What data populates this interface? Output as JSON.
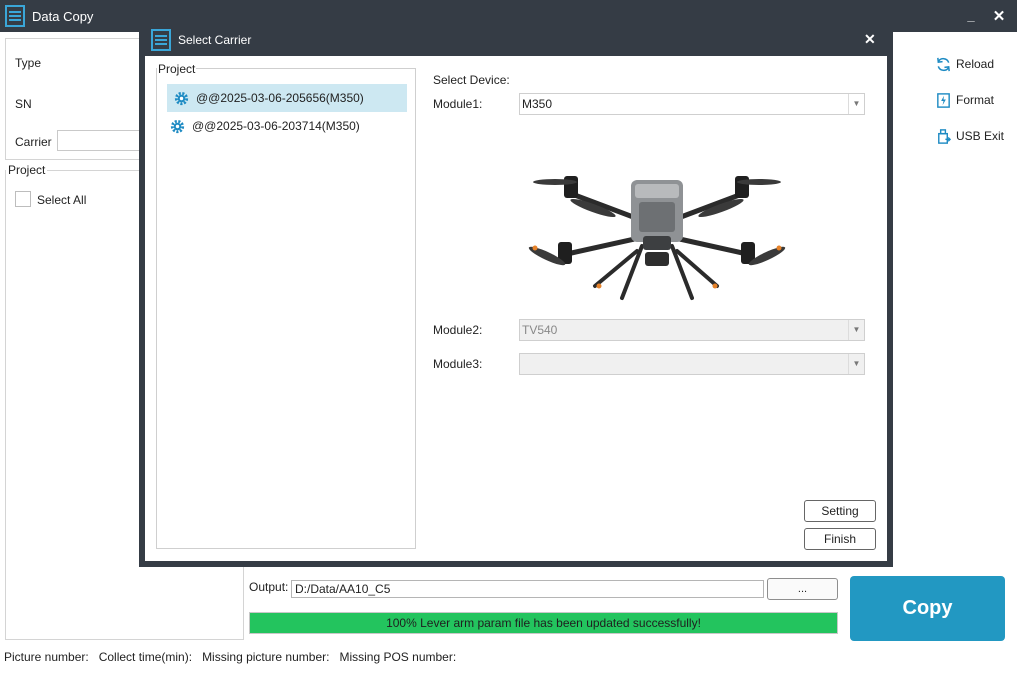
{
  "window": {
    "title": "Data Copy",
    "minimize_glyph": "_",
    "close_glyph": "✕"
  },
  "info": {
    "type_label": "Type",
    "sn_label": "SN",
    "carrier_label": "Carrier"
  },
  "project_panel": {
    "legend": "Project",
    "select_all_label": "Select All"
  },
  "side_buttons": {
    "reload": "Reload",
    "format": "Format",
    "usb_exit": "USB Exit"
  },
  "output": {
    "label": "Output:",
    "path": "D:/Data/AA10_C5",
    "browse_label": "...",
    "progress_text": "100% Lever arm param file has been updated successfully!",
    "progress_percent": 100
  },
  "copy_button": "Copy",
  "status_bar": {
    "picture_number": "Picture number:",
    "collect_time": "Collect time(min):",
    "missing_picture": "Missing picture number:",
    "missing_pos": "Missing POS number:"
  },
  "dialog": {
    "title": "Select Carrier",
    "close_glyph": "✕",
    "project_legend": "Project",
    "projects": [
      {
        "name": "@@2025-03-06-205656(M350)",
        "selected": true
      },
      {
        "name": "@@2025-03-06-203714(M350)",
        "selected": false
      }
    ],
    "select_device_label": "Select Device:",
    "module1_label": "Module1:",
    "module1_value": "M350",
    "module2_label": "Module2:",
    "module2_value": "TV540",
    "module3_label": "Module3:",
    "module3_value": "",
    "setting_button": "Setting",
    "finish_button": "Finish"
  },
  "colors": {
    "titlebar": "#353c45",
    "accent": "#2298c2",
    "progress": "#23c45e",
    "selected_row": "#cde8f2"
  },
  "icons": {
    "app": "document-list-icon",
    "reload": "refresh-icon",
    "format": "format-drive-icon",
    "usb_exit": "usb-exit-icon",
    "project": "gear-icon"
  }
}
